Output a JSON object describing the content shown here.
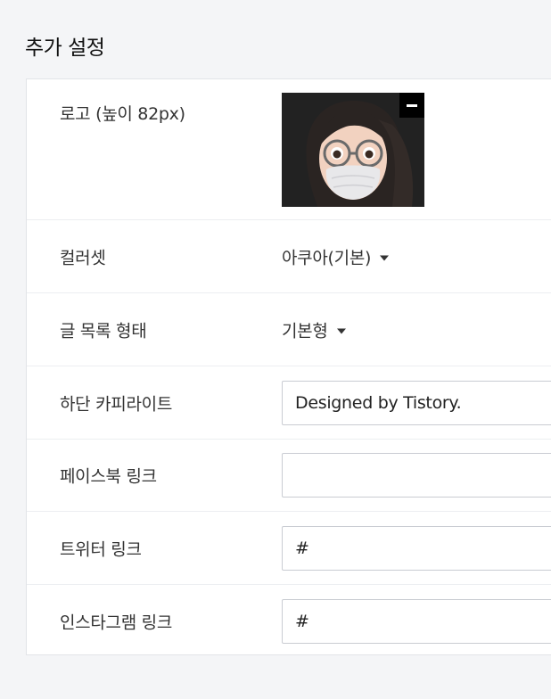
{
  "section": {
    "title": "추가 설정"
  },
  "rows": {
    "logo": {
      "label": "로고 (높이 82px)"
    },
    "colorset": {
      "label": "컬러셋",
      "value": "아쿠아(기본)"
    },
    "post_list": {
      "label": "글 목록 형태",
      "value": "기본형"
    },
    "copyright": {
      "label": "하단 카피라이트",
      "value": "Designed by Tistory.",
      "placeholder": ""
    },
    "facebook": {
      "label": "페이스북 링크",
      "value": "",
      "placeholder": ""
    },
    "twitter": {
      "label": "트위터 링크",
      "value": "#",
      "placeholder": ""
    },
    "instagram": {
      "label": "인스타그램 링크",
      "value": "#",
      "placeholder": ""
    }
  },
  "icons": {
    "remove": "minus-icon",
    "dropdown": "caret-down-icon"
  }
}
